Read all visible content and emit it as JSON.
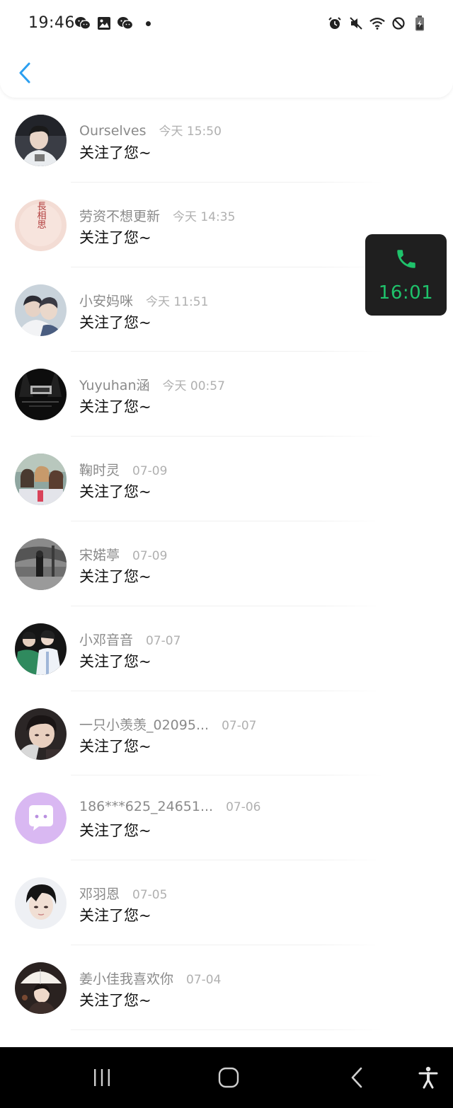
{
  "status_bar": {
    "time": "19:46",
    "left_icons": [
      "wechat-icon",
      "image-icon",
      "wechat-icon"
    ],
    "right_icons": [
      "alarm-icon",
      "mute-icon",
      "wifi-icon",
      "block-icon",
      "battery-charging-icon"
    ]
  },
  "nav": {
    "back_icon": "chevron-left-icon",
    "accent_color": "#2b9ff0"
  },
  "notifications": [
    {
      "name": "Ourselves",
      "time": "今天 15:50",
      "message": "关注了您~",
      "avatar": "photo-avatar"
    },
    {
      "name": "劳资不想更新",
      "time": "今天 14:35",
      "message": "关注了您~",
      "avatar": "calligraphy-avatar",
      "avatar_text": "長相思"
    },
    {
      "name": "小安妈咪",
      "time": "今天 11:51",
      "message": "关注了您~",
      "avatar": "photo-avatar"
    },
    {
      "name": "Yuyuhan涵",
      "time": "今天 00:57",
      "message": "关注了您~",
      "avatar": "stage-avatar"
    },
    {
      "name": "鞠时灵",
      "time": "07-09",
      "message": "关注了您~",
      "avatar": "photo-avatar"
    },
    {
      "name": "宋婼葶",
      "time": "07-09",
      "message": "关注了您~",
      "avatar": "photo-avatar"
    },
    {
      "name": "小邓音音",
      "time": "07-07",
      "message": "关注了您~",
      "avatar": "photo-avatar"
    },
    {
      "name": "一只小羡羡_02095...",
      "time": "07-07",
      "message": "关注了您~",
      "avatar": "photo-avatar"
    },
    {
      "name": "186***625_24651...",
      "time": "07-06",
      "message": "关注了您~",
      "avatar": "default-chat-avatar"
    },
    {
      "name": "邓羽恩",
      "time": "07-05",
      "message": "关注了您~",
      "avatar": "photo-avatar"
    },
    {
      "name": "姜小佳我喜欢你",
      "time": "07-04",
      "message": "关注了您~",
      "avatar": "photo-avatar"
    }
  ],
  "call_bubble": {
    "timer": "16:01",
    "icon": "phone-icon",
    "color": "#1fc26b"
  },
  "system_nav": {
    "buttons": [
      "recent-apps-icon",
      "home-icon",
      "back-icon",
      "accessibility-icon"
    ]
  }
}
